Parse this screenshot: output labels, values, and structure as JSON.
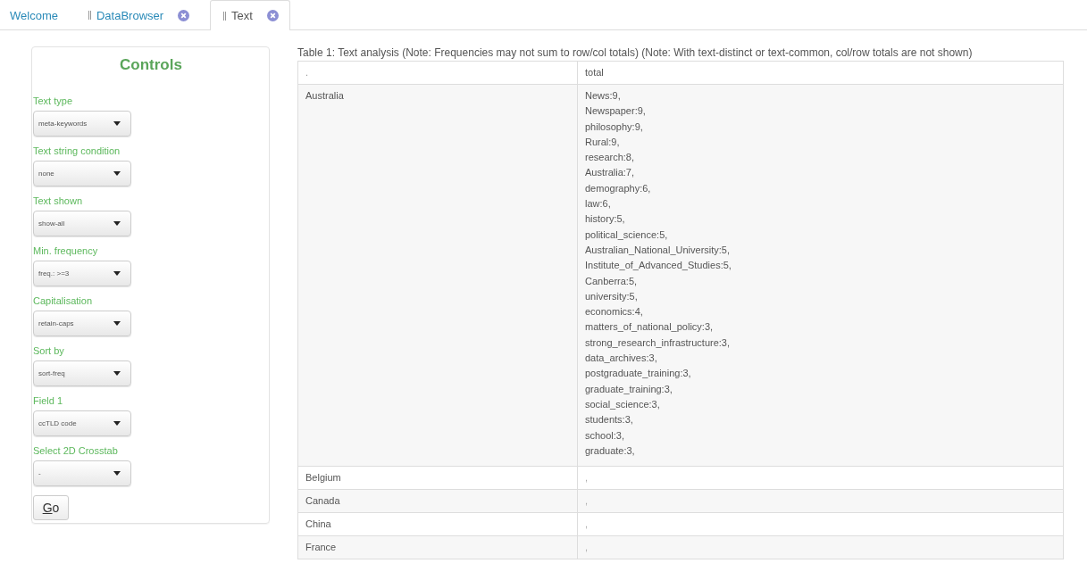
{
  "tabs": [
    {
      "label": "Welcome",
      "selected": false,
      "closable": false
    },
    {
      "label": "DataBrowser",
      "selected": false,
      "closable": true
    },
    {
      "label": "Text",
      "selected": true,
      "closable": true
    }
  ],
  "controls": {
    "title": "Controls",
    "fields": [
      {
        "label": "Text type",
        "value": "meta-keywords"
      },
      {
        "label": "Text string condition",
        "value": "none"
      },
      {
        "label": "Text shown",
        "value": "show-all"
      },
      {
        "label": "Min. frequency",
        "value": "freq.: >=3"
      },
      {
        "label": "Capitalisation",
        "value": "retain-caps"
      },
      {
        "label": "Sort by",
        "value": "sort-freq"
      },
      {
        "label": "Field 1",
        "value": "ccTLD code"
      },
      {
        "label": "Select 2D Crosstab",
        "value": "-"
      }
    ],
    "go_button": {
      "label": "Go"
    }
  },
  "table": {
    "caption": "Table 1: Text analysis (Note: Frequencies may not sum to row/col totals) (Note: With text-distinct or text-common, col/row totals are not shown)",
    "columns": [
      ".",
      "total"
    ],
    "rows": [
      {
        "label": "Australia",
        "values": [
          "News:9,",
          "Newspaper:9,",
          "philosophy:9,",
          "Rural:9,",
          "research:8,",
          "Australia:7,",
          "demography:6,",
          "law:6,",
          "history:5,",
          "political_science:5,",
          "Australian_National_University:5,",
          "Institute_of_Advanced_Studies:5,",
          "Canberra:5,",
          "university:5,",
          "economics:4,",
          "matters_of_national_policy:3,",
          "strong_research_infrastructure:3,",
          "data_archives:3,",
          "postgraduate_training:3,",
          "graduate_training:3,",
          "social_science:3,",
          "students:3,",
          "school:3,",
          "graduate:3,"
        ]
      },
      {
        "label": "Belgium",
        "values": [
          ","
        ]
      },
      {
        "label": "Canada",
        "values": [
          ","
        ]
      },
      {
        "label": "China",
        "values": [
          ","
        ]
      },
      {
        "label": "France",
        "values": [
          ","
        ]
      }
    ]
  }
}
